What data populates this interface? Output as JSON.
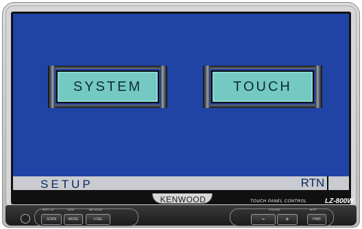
{
  "screen": {
    "buttons": [
      {
        "label": "SYSTEM"
      },
      {
        "label": "TOUCH"
      }
    ],
    "title_bar": "SETUP",
    "return_button": "RTN"
  },
  "device": {
    "brand": "KENWOOD",
    "tagline": "TOUCH PANEL CONTROL",
    "model": "LZ-800W",
    "buttons": {
      "scrn": "SCRN",
      "mode": "MODE",
      "vsel": "V.SEL",
      "minus": "–",
      "plus": "+",
      "pwr": "PWR"
    },
    "captions": {
      "setup": "●SET UP",
      "wide": "WIDE",
      "ir_mode": "●IR MODE",
      "volume": "VOLUME",
      "off": "●OFF"
    }
  }
}
